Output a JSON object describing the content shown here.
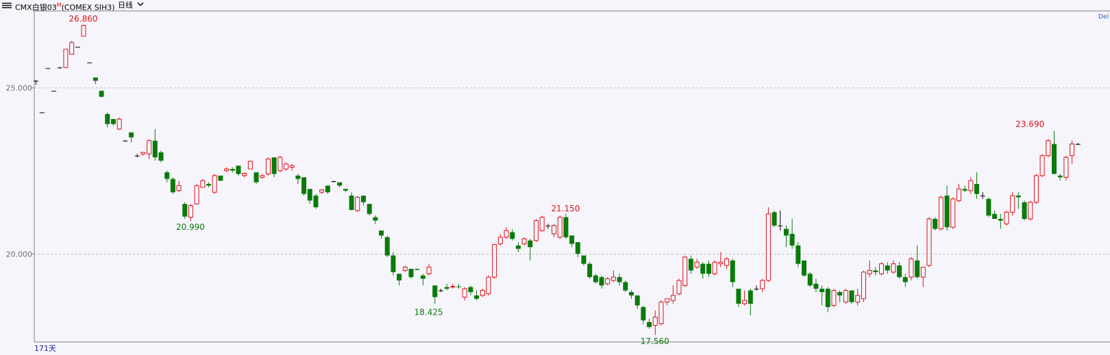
{
  "header": {
    "instrument": "CMX白银03",
    "mark": "M",
    "exchange": "(COMEX SIH3)",
    "period": "日线",
    "dropdown_icon": "chevron-down-icon",
    "menu_icon": "bars-icon"
  },
  "corner_label": "Del",
  "footer": {
    "days": "171天"
  },
  "colors": {
    "up": "#e0101a",
    "down": "#0a7a0a",
    "flat": "#000000",
    "grid": "#bdbdbd",
    "axis": "#808080",
    "axis_label": "#707070"
  },
  "chart_data": {
    "type": "candlestick",
    "y_ticks": [
      {
        "value": 25,
        "label": "25.000"
      },
      {
        "value": 20,
        "label": "20.000"
      }
    ],
    "ylim": [
      17.35,
      27.3
    ],
    "bars_total": 171,
    "candles": [
      [
        25.2,
        25.22,
        25.08,
        25.2
      ],
      [
        24.25,
        24.25,
        24.25,
        24.25
      ],
      [
        25.58,
        25.58,
        25.58,
        25.58
      ],
      [
        24.9,
        24.9,
        24.9,
        24.9
      ],
      [
        25.6,
        25.62,
        25.58,
        25.6
      ],
      [
        25.6,
        26.15,
        25.58,
        26.15
      ],
      [
        26.0,
        26.4,
        26.0,
        26.35
      ],
      [
        26.22,
        26.22,
        26.2,
        26.22
      ],
      [
        26.54,
        26.9,
        26.54,
        26.86
      ],
      [
        25.75,
        25.75,
        25.75,
        25.75
      ],
      [
        25.3,
        25.3,
        25.1,
        25.2
      ],
      [
        24.9,
        24.9,
        24.7,
        24.72
      ],
      [
        24.2,
        24.25,
        23.8,
        23.9
      ],
      [
        24.05,
        24.05,
        23.85,
        23.9
      ],
      [
        23.75,
        24.1,
        23.72,
        24.05
      ],
      [
        23.4,
        23.42,
        23.38,
        23.4
      ],
      [
        23.65,
        23.65,
        23.35,
        23.5
      ],
      [
        22.95,
        23.0,
        22.9,
        22.95
      ],
      [
        23.0,
        23.05,
        22.95,
        23.05
      ],
      [
        23.0,
        23.45,
        22.85,
        23.4
      ],
      [
        23.4,
        23.75,
        22.8,
        22.9
      ],
      [
        23.05,
        23.1,
        22.75,
        22.8
      ],
      [
        22.45,
        22.5,
        22.15,
        22.25
      ],
      [
        22.25,
        22.3,
        21.8,
        21.85
      ],
      [
        21.9,
        22.2,
        21.85,
        22.05
      ],
      [
        21.5,
        21.55,
        21.05,
        21.12
      ],
      [
        21.1,
        21.5,
        20.99,
        21.45
      ],
      [
        21.5,
        22.1,
        21.48,
        22.05
      ],
      [
        22.0,
        22.25,
        22.0,
        22.2
      ],
      [
        22.1,
        22.15,
        22.0,
        22.05
      ],
      [
        21.85,
        22.4,
        21.8,
        22.35
      ],
      [
        22.35,
        22.35,
        22.18,
        22.2
      ],
      [
        22.5,
        22.6,
        22.45,
        22.55
      ],
      [
        22.55,
        22.6,
        22.45,
        22.5
      ],
      [
        22.65,
        22.65,
        22.35,
        22.4
      ],
      [
        22.35,
        22.45,
        22.3,
        22.42
      ],
      [
        22.55,
        22.8,
        22.55,
        22.78
      ],
      [
        22.45,
        22.45,
        22.1,
        22.15
      ],
      [
        22.3,
        22.4,
        22.25,
        22.35
      ],
      [
        22.4,
        22.9,
        22.35,
        22.85
      ],
      [
        22.9,
        22.9,
        22.3,
        22.4
      ],
      [
        22.5,
        22.95,
        22.45,
        22.9
      ],
      [
        22.55,
        22.75,
        22.5,
        22.7
      ],
      [
        22.6,
        22.7,
        22.5,
        22.65
      ],
      [
        22.35,
        22.4,
        22.1,
        22.25
      ],
      [
        22.3,
        22.3,
        21.75,
        21.8
      ],
      [
        21.95,
        21.95,
        21.5,
        21.6
      ],
      [
        21.75,
        21.8,
        21.35,
        21.4
      ],
      [
        21.85,
        21.95,
        21.8,
        21.92
      ],
      [
        22.05,
        22.05,
        21.8,
        21.85
      ],
      [
        22.18,
        22.2,
        22.15,
        22.18
      ],
      [
        22.15,
        22.15,
        22.0,
        22.05
      ],
      [
        21.95,
        21.95,
        21.85,
        21.9
      ],
      [
        21.75,
        21.85,
        21.3,
        21.32
      ],
      [
        21.3,
        21.75,
        21.25,
        21.7
      ],
      [
        21.75,
        21.75,
        21.45,
        21.55
      ],
      [
        21.5,
        21.5,
        21.15,
        21.2
      ],
      [
        21.1,
        21.15,
        20.9,
        21.0
      ],
      [
        20.7,
        20.7,
        20.45,
        20.55
      ],
      [
        20.5,
        20.55,
        19.9,
        19.95
      ],
      [
        19.95,
        20.05,
        19.35,
        19.45
      ],
      [
        19.4,
        19.4,
        19.05,
        19.2
      ],
      [
        19.5,
        19.65,
        19.45,
        19.6
      ],
      [
        19.55,
        19.55,
        19.25,
        19.3
      ],
      [
        19.55,
        19.55,
        19.5,
        19.52
      ],
      [
        19.35,
        19.4,
        19.05,
        19.25
      ],
      [
        19.4,
        19.7,
        19.35,
        19.6
      ],
      [
        19.05,
        19.05,
        18.5,
        18.7
      ],
      [
        18.9,
        18.95,
        18.85,
        18.9
      ],
      [
        19.0,
        19.1,
        18.9,
        18.95
      ],
      [
        19.0,
        19.1,
        18.95,
        19.02
      ],
      [
        19.02,
        19.1,
        18.95,
        19.0
      ],
      [
        18.7,
        19.0,
        18.6,
        18.95
      ],
      [
        19.0,
        19.05,
        18.75,
        18.85
      ],
      [
        18.75,
        18.9,
        18.6,
        18.65
      ],
      [
        18.75,
        18.95,
        18.7,
        18.9
      ],
      [
        18.8,
        19.35,
        18.75,
        19.3
      ],
      [
        19.3,
        20.3,
        19.25,
        20.28
      ],
      [
        20.3,
        20.6,
        20.25,
        20.5
      ],
      [
        20.5,
        20.8,
        20.45,
        20.7
      ],
      [
        20.65,
        20.75,
        20.4,
        20.45
      ],
      [
        20.25,
        20.35,
        20.05,
        20.15
      ],
      [
        20.3,
        20.5,
        20.25,
        20.45
      ],
      [
        20.4,
        20.45,
        19.8,
        20.2
      ],
      [
        20.4,
        21.05,
        20.35,
        21.0
      ],
      [
        20.7,
        21.15,
        20.65,
        21.1
      ],
      [
        20.85,
        20.9,
        20.75,
        20.85
      ],
      [
        20.6,
        20.9,
        20.5,
        20.85
      ],
      [
        20.5,
        21.15,
        20.45,
        21.1
      ],
      [
        21.1,
        21.2,
        20.45,
        20.5
      ],
      [
        20.55,
        20.55,
        20.2,
        20.3
      ],
      [
        20.35,
        20.35,
        19.9,
        20.0
      ],
      [
        19.95,
        19.95,
        19.65,
        19.7
      ],
      [
        19.7,
        19.75,
        19.25,
        19.3
      ],
      [
        19.35,
        19.4,
        19.1,
        19.15
      ],
      [
        19.3,
        19.35,
        18.95,
        19.05
      ],
      [
        19.1,
        19.3,
        19.05,
        19.25
      ],
      [
        19.2,
        19.5,
        19.15,
        19.3
      ],
      [
        19.3,
        19.4,
        19.05,
        19.15
      ],
      [
        19.15,
        19.2,
        18.85,
        18.9
      ],
      [
        18.85,
        18.9,
        18.65,
        18.75
      ],
      [
        18.75,
        18.75,
        18.35,
        18.45
      ],
      [
        18.4,
        18.45,
        17.9,
        18.0
      ],
      [
        17.95,
        18.05,
        17.75,
        17.8
      ],
      [
        17.85,
        18.3,
        17.56,
        18.1
      ],
      [
        17.9,
        18.6,
        17.85,
        18.55
      ],
      [
        18.55,
        18.65,
        18.45,
        18.65
      ],
      [
        18.6,
        19.05,
        18.5,
        18.75
      ],
      [
        18.8,
        19.25,
        18.75,
        19.2
      ],
      [
        19.05,
        19.95,
        19.0,
        19.9
      ],
      [
        19.85,
        19.95,
        19.4,
        19.5
      ],
      [
        19.6,
        19.85,
        19.55,
        19.75
      ],
      [
        19.7,
        19.75,
        19.25,
        19.4
      ],
      [
        19.7,
        19.8,
        19.3,
        19.4
      ],
      [
        19.4,
        19.8,
        19.35,
        19.75
      ],
      [
        19.7,
        20.05,
        19.6,
        19.75
      ],
      [
        19.65,
        19.9,
        19.55,
        19.85
      ],
      [
        19.8,
        19.85,
        19.0,
        19.15
      ],
      [
        18.95,
        18.95,
        18.4,
        18.5
      ],
      [
        18.5,
        18.9,
        18.45,
        18.6
      ],
      [
        18.9,
        18.95,
        18.15,
        18.5
      ],
      [
        18.95,
        19.05,
        18.9,
        18.95
      ],
      [
        18.95,
        19.25,
        18.85,
        19.2
      ],
      [
        19.2,
        21.4,
        19.15,
        21.2
      ],
      [
        21.25,
        21.3,
        20.8,
        20.85
      ],
      [
        20.85,
        21.3,
        20.7,
        20.85
      ],
      [
        20.75,
        20.85,
        20.2,
        20.55
      ],
      [
        20.6,
        21.05,
        20.15,
        20.25
      ],
      [
        20.25,
        20.35,
        19.6,
        19.7
      ],
      [
        19.8,
        19.8,
        19.3,
        19.35
      ],
      [
        19.4,
        19.45,
        19.0,
        19.05
      ],
      [
        19.1,
        19.25,
        18.85,
        18.95
      ],
      [
        18.95,
        19.05,
        18.45,
        18.85
      ],
      [
        18.95,
        19.0,
        18.25,
        18.4
      ],
      [
        18.45,
        18.95,
        18.4,
        18.9
      ],
      [
        18.85,
        18.9,
        18.55,
        18.75
      ],
      [
        18.55,
        18.95,
        18.5,
        18.9
      ],
      [
        18.9,
        18.9,
        18.5,
        18.55
      ],
      [
        18.55,
        18.95,
        18.45,
        18.75
      ],
      [
        18.65,
        19.5,
        18.55,
        19.45
      ],
      [
        19.4,
        19.8,
        19.3,
        19.5
      ],
      [
        19.5,
        19.6,
        19.35,
        19.45
      ],
      [
        19.4,
        19.75,
        19.35,
        19.7
      ],
      [
        19.65,
        19.75,
        19.4,
        19.5
      ],
      [
        19.45,
        19.8,
        19.4,
        19.7
      ],
      [
        19.65,
        19.75,
        19.25,
        19.3
      ],
      [
        19.3,
        19.4,
        19.0,
        19.15
      ],
      [
        19.3,
        19.9,
        19.2,
        19.85
      ],
      [
        19.8,
        20.25,
        19.25,
        19.3
      ],
      [
        19.3,
        19.6,
        19.0,
        19.6
      ],
      [
        19.65,
        21.1,
        19.6,
        21.05
      ],
      [
        21.05,
        21.1,
        20.7,
        20.75
      ],
      [
        20.75,
        21.75,
        20.7,
        21.7
      ],
      [
        21.75,
        22.05,
        20.7,
        20.8
      ],
      [
        20.8,
        21.7,
        20.75,
        21.65
      ],
      [
        21.6,
        22.1,
        21.55,
        21.95
      ],
      [
        21.95,
        22.05,
        21.85,
        21.9
      ],
      [
        21.9,
        22.3,
        21.8,
        22.2
      ],
      [
        22.1,
        22.45,
        21.65,
        21.8
      ],
      [
        21.75,
        21.85,
        21.65,
        21.75
      ],
      [
        21.65,
        21.7,
        21.1,
        21.15
      ],
      [
        21.2,
        21.3,
        21.05,
        21.05
      ],
      [
        21.05,
        21.2,
        20.75,
        21.0
      ],
      [
        20.9,
        21.3,
        20.85,
        21.25
      ],
      [
        21.25,
        21.85,
        21.15,
        21.75
      ],
      [
        21.75,
        21.85,
        21.35,
        21.7
      ],
      [
        21.55,
        21.6,
        21.0,
        21.05
      ],
      [
        21.05,
        21.6,
        21.0,
        21.55
      ],
      [
        21.55,
        22.4,
        21.5,
        22.35
      ],
      [
        22.35,
        23.0,
        22.3,
        22.95
      ],
      [
        22.95,
        23.45,
        22.9,
        23.4
      ],
      [
        23.3,
        23.7,
        22.4,
        22.4
      ],
      [
        22.35,
        22.4,
        22.2,
        22.3
      ],
      [
        22.3,
        22.95,
        22.2,
        22.9
      ],
      [
        22.95,
        23.4,
        22.7,
        23.3
      ],
      [
        23.3,
        23.33,
        23.27,
        23.3
      ]
    ],
    "annotations": [
      {
        "index": 8,
        "value": 26.86,
        "label": "26.860",
        "position": "above",
        "color": "up"
      },
      {
        "index": 26,
        "value": 20.99,
        "label": "20.990",
        "position": "below",
        "color": "down"
      },
      {
        "index": 66,
        "value": 18.425,
        "label": "18.425",
        "position": "below",
        "color": "down"
      },
      {
        "index": 89,
        "value": 21.15,
        "label": "21.150",
        "position": "above",
        "color": "up"
      },
      {
        "index": 104,
        "value": 17.56,
        "label": "17.560",
        "position": "below",
        "color": "down"
      },
      {
        "index": 167,
        "value": 23.69,
        "label": "23.690",
        "position": "above",
        "color": "up"
      }
    ]
  }
}
